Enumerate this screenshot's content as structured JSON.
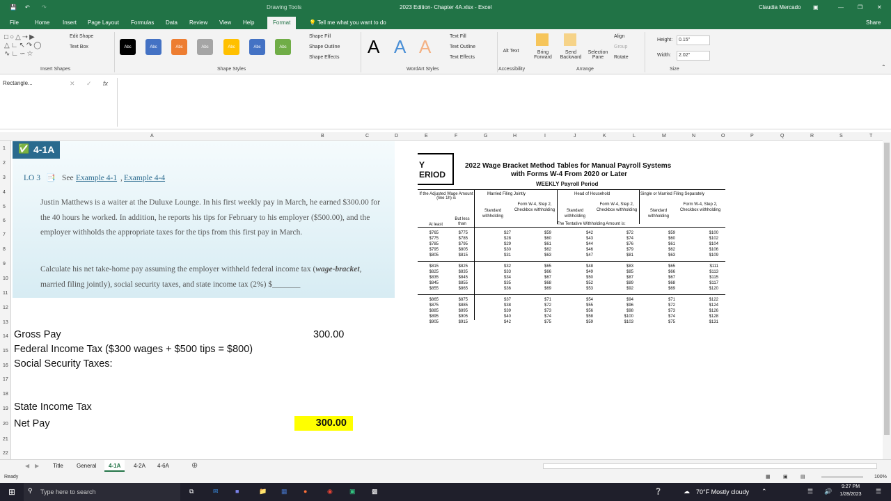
{
  "window": {
    "title": "2023 Edition- Chapter 4A.xlsx - Excel",
    "context_tab": "Drawing Tools",
    "user": "Claudia Mercado"
  },
  "tabs": [
    "File",
    "Home",
    "Insert",
    "Page Layout",
    "Formulas",
    "Data",
    "Review",
    "View",
    "Help",
    "Format"
  ],
  "tell_me": "Tell me what you want to do",
  "share": "Share",
  "ribbon": {
    "edit_shape": "Edit Shape",
    "text_box": "Text Box",
    "insert_shapes": "Insert Shapes",
    "shape_styles": "Shape Styles",
    "shape_fill": "Shape Fill",
    "shape_outline": "Shape Outline",
    "shape_effects": "Shape Effects",
    "swatch_label": "Abc",
    "swatch_colors": [
      "#000000",
      "#4472c4",
      "#ed7d31",
      "#a5a5a5",
      "#ffc000",
      "#4472c4",
      "#70ad47"
    ],
    "text_fill": "Text Fill",
    "text_outline": "Text Outline",
    "text_effects": "Text Effects",
    "wordart_styles": "WordArt Styles",
    "alt_text": "Alt Text",
    "accessibility": "Accessibility",
    "bring_forward": "Bring Forward",
    "send_backward": "Send Backward",
    "selection_pane": "Selection Pane",
    "align": "Align",
    "group": "Group",
    "rotate": "Rotate",
    "arrange": "Arrange",
    "height_label": "Height:",
    "height_value": "0.15\"",
    "width_label": "Width:",
    "width_value": "2.02\"",
    "size": "Size"
  },
  "name_box": "Rectangle...",
  "columns": [
    "A",
    "B",
    "C",
    "D",
    "E",
    "F",
    "G",
    "H",
    "I",
    "J",
    "K",
    "L",
    "M",
    "N",
    "O",
    "P",
    "Q",
    "R",
    "S",
    "T"
  ],
  "rows": [
    "1",
    "2",
    "3",
    "4",
    "5",
    "6",
    "7",
    "8",
    "9",
    "10",
    "11",
    "12",
    "13",
    "14",
    "15",
    "16",
    "17",
    "18",
    "19",
    "20",
    "21",
    "22"
  ],
  "problem": {
    "badge": "4-1A",
    "lo": "LO 3",
    "see": "See",
    "link1": "Example 4-1",
    "comma": ",",
    "link2": "Example 4-4",
    "para1": "Justin Matthews is a waiter at the Duluxe Lounge. In his first weekly pay in March, he earned $300.00 for the 40 hours he worked. In addition, he reports his tips for February to his employer ($500.00), and the employer withholds the appropriate taxes for the tips from this first pay in March.",
    "para2a": "Calculate his net take-home pay assuming the employer withheld federal income tax (",
    "para2b": "wage-bracket",
    "para2c": ", married filing jointly), social security taxes, and state income tax (2%) $_______"
  },
  "cells": {
    "gross_pay": "Gross Pay",
    "gross_val": "300.00",
    "fed_tax": "Federal Income Tax ($300 wages + $500 tips = $800)",
    "ss_tax": "Social Security Taxes:",
    "state_tax": "State Income Tax",
    "net_pay": "Net Pay",
    "net_val": "300.00"
  },
  "wage_table": {
    "corner1": "Y",
    "corner2": "ERIOD",
    "title1": "2022 Wage Bracket Method Tables for Manual Payroll Systems",
    "title2": "with Forms W-4 From 2020 or Later",
    "subtitle": "WEEKLY Payroll Period",
    "col_adj": "If the Adjusted Wage Amount (line 1h) is",
    "col_mfj": "Married Filing Jointly",
    "col_hoh": "Head of Household",
    "col_single": "Single or Married Filing Separately",
    "w4": "Form W-4, Step 2, Checkbox withholding",
    "standard": "Standard withholding",
    "at_least": "At least",
    "but_less": "But less than",
    "tentative": "The Tentative Withholding Amount is:",
    "rows": [
      [
        "$765",
        "$775",
        "$27",
        "$59",
        "$42",
        "$72",
        "$59",
        "$100"
      ],
      [
        "$775",
        "$785",
        "$28",
        "$60",
        "$43",
        "$74",
        "$60",
        "$102"
      ],
      [
        "$785",
        "$795",
        "$29",
        "$61",
        "$44",
        "$76",
        "$61",
        "$104"
      ],
      [
        "$795",
        "$805",
        "$30",
        "$62",
        "$46",
        "$79",
        "$62",
        "$106"
      ],
      [
        "$805",
        "$815",
        "$31",
        "$63",
        "$47",
        "$81",
        "$63",
        "$109"
      ],
      [
        "$815",
        "$825",
        "$32",
        "$65",
        "$48",
        "$83",
        "$65",
        "$111"
      ],
      [
        "$825",
        "$835",
        "$33",
        "$66",
        "$49",
        "$85",
        "$66",
        "$113"
      ],
      [
        "$835",
        "$845",
        "$34",
        "$67",
        "$50",
        "$87",
        "$67",
        "$115"
      ],
      [
        "$845",
        "$855",
        "$35",
        "$68",
        "$52",
        "$89",
        "$68",
        "$117"
      ],
      [
        "$855",
        "$865",
        "$36",
        "$69",
        "$53",
        "$92",
        "$69",
        "$120"
      ],
      [
        "$865",
        "$875",
        "$37",
        "$71",
        "$54",
        "$94",
        "$71",
        "$122"
      ],
      [
        "$875",
        "$885",
        "$38",
        "$72",
        "$55",
        "$96",
        "$72",
        "$124"
      ],
      [
        "$885",
        "$895",
        "$39",
        "$73",
        "$56",
        "$98",
        "$73",
        "$126"
      ],
      [
        "$895",
        "$905",
        "$40",
        "$74",
        "$58",
        "$100",
        "$74",
        "$128"
      ],
      [
        "$905",
        "$915",
        "$42",
        "$75",
        "$59",
        "$103",
        "$75",
        "$131"
      ]
    ]
  },
  "sheet_tabs": [
    "Title",
    "General",
    "4-1A",
    "4-2A",
    "4-6A"
  ],
  "status": {
    "ready": "Ready",
    "zoom": "100%"
  },
  "taskbar": {
    "search": "Type here to search",
    "weather": "70°F  Mostly cloudy",
    "time": "9:27 PM",
    "date": "1/28/2023"
  }
}
